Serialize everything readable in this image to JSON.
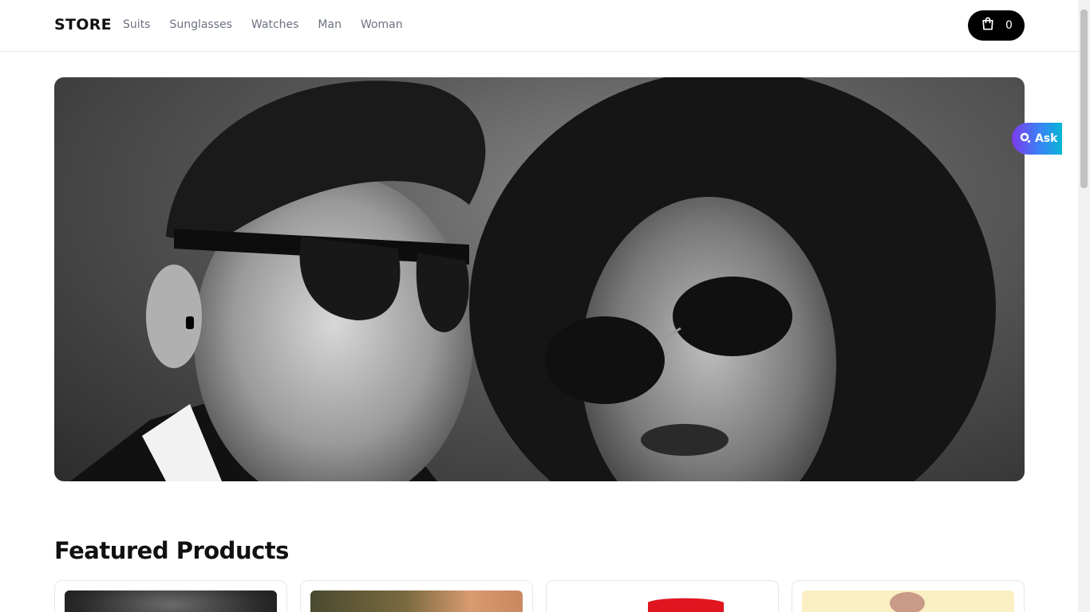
{
  "header": {
    "logo": "STORE",
    "nav": [
      "Suits",
      "Sunglasses",
      "Watches",
      "Man",
      "Woman"
    ],
    "cart_count": "0",
    "cart_icon": "shopping-bag-icon"
  },
  "hero": {
    "image": "black-and-white photo of a man and a woman wearing sunglasses"
  },
  "ask_widget": {
    "label": "Ask",
    "icon": "search-icon",
    "colors": [
      "#7c3aed",
      "#3b82f6",
      "#06b6d4"
    ]
  },
  "featured": {
    "title": "Featured Products",
    "products": [
      {
        "image": "dark product photo"
      },
      {
        "image": "olive and peach product photo"
      },
      {
        "image": "red product on white"
      },
      {
        "image": "person on cream background"
      }
    ]
  }
}
